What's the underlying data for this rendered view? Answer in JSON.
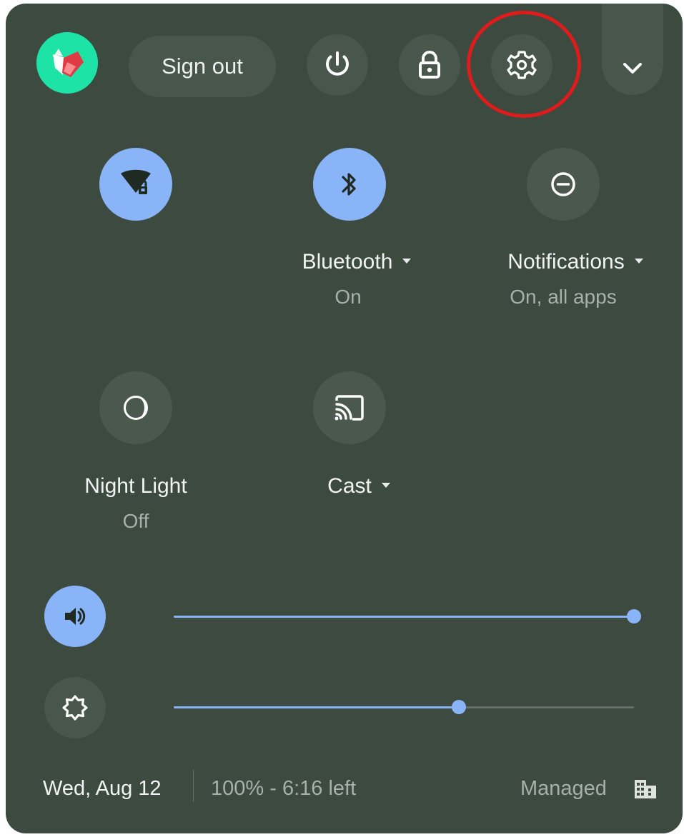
{
  "header": {
    "sign_out_label": "Sign out",
    "power_icon": "power-icon",
    "lock_icon": "lock-icon",
    "settings_icon": "gear-icon",
    "collapse_icon": "chevron-down-icon"
  },
  "tiles": [
    {
      "name": "wifi",
      "icon": "wifi-icon",
      "label": "",
      "status": "",
      "active": true
    },
    {
      "name": "bluetooth",
      "icon": "bluetooth-icon",
      "label": "Bluetooth",
      "status": "On",
      "active": true
    },
    {
      "name": "notifications",
      "icon": "do-not-disturb-icon",
      "label": "Notifications",
      "status": "On, all apps",
      "active": false
    },
    {
      "name": "night-light",
      "icon": "night-light-icon",
      "label": "Night Light",
      "status": "Off",
      "active": false
    },
    {
      "name": "cast",
      "icon": "cast-icon",
      "label": "Cast",
      "status": "",
      "active": false
    }
  ],
  "sliders": {
    "volume": {
      "icon": "volume-icon",
      "value": 1.0
    },
    "brightness": {
      "icon": "brightness-icon",
      "value": 0.62
    }
  },
  "footer": {
    "date": "Wed, Aug 12",
    "battery": "100% - 6:16 left",
    "managed": "Managed",
    "managed_icon": "building-icon"
  },
  "colors": {
    "panel_bg": "#3c4a3f",
    "accent": "#8ab4f8",
    "highlight": "#e01b1b"
  }
}
